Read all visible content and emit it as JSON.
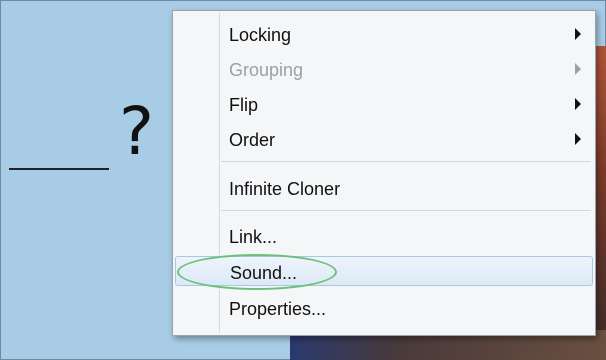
{
  "canvas": {
    "placeholder_mark": "?"
  },
  "context_menu": {
    "items": [
      {
        "label": "Locking",
        "has_submenu": true,
        "enabled": true
      },
      {
        "label": "Grouping",
        "has_submenu": true,
        "enabled": false
      },
      {
        "label": "Flip",
        "has_submenu": true,
        "enabled": true
      },
      {
        "label": "Order",
        "has_submenu": true,
        "enabled": true
      },
      {
        "label": "Infinite Cloner",
        "has_submenu": false,
        "enabled": true
      },
      {
        "label": "Link...",
        "has_submenu": false,
        "enabled": true
      },
      {
        "label": "Sound...",
        "has_submenu": false,
        "enabled": true,
        "highlighted": true
      },
      {
        "label": "Properties...",
        "has_submenu": false,
        "enabled": true
      }
    ]
  },
  "colors": {
    "canvas_background": "#a9cce6",
    "menu_background": "#f4f6f8",
    "highlight_ellipse": "#6cc07a",
    "disabled_text": "#9aa0a6"
  }
}
